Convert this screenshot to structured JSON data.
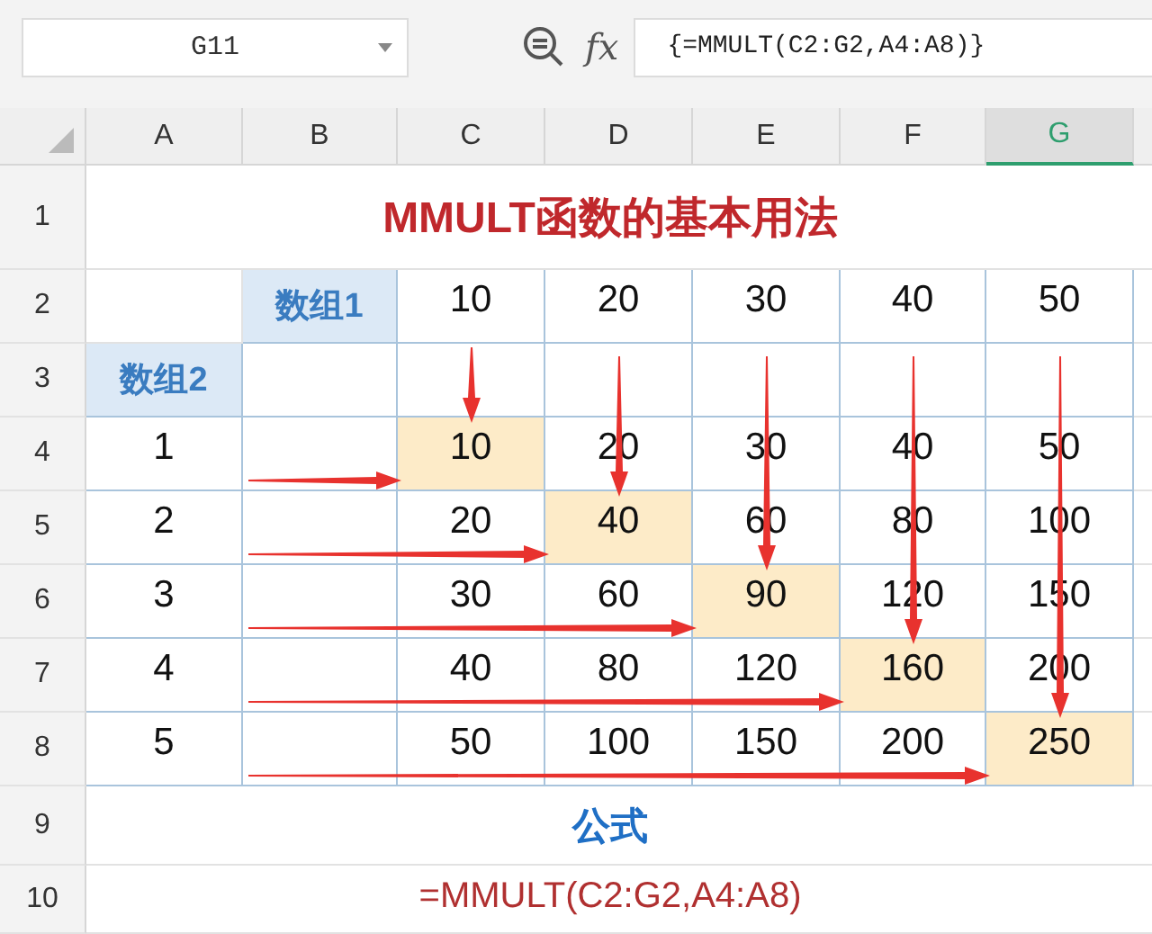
{
  "name_box": "G11",
  "fx_label": "fx",
  "formula_bar": "{=MMULT(C2:G2,A4:A8)}",
  "columns": [
    {
      "label": "A",
      "selected": false
    },
    {
      "label": "B",
      "selected": false
    },
    {
      "label": "C",
      "selected": false
    },
    {
      "label": "D",
      "selected": false
    },
    {
      "label": "E",
      "selected": false
    },
    {
      "label": "F",
      "selected": false
    },
    {
      "label": "G",
      "selected": true
    }
  ],
  "rows": [
    {
      "number": "1",
      "kind": "title",
      "text": "MMULT函数的基本用法"
    },
    {
      "number": "2",
      "kind": "data",
      "cells": [
        {
          "kind": "gap"
        },
        {
          "kind": "label",
          "text": "数组1"
        },
        {
          "kind": "value",
          "text": "10",
          "highlighted": false
        },
        {
          "kind": "value",
          "text": "20",
          "highlighted": false
        },
        {
          "kind": "value",
          "text": "30",
          "highlighted": false
        },
        {
          "kind": "value",
          "text": "40",
          "highlighted": false
        },
        {
          "kind": "value",
          "text": "50",
          "highlighted": false
        }
      ]
    },
    {
      "number": "3",
      "kind": "data",
      "cells": [
        {
          "kind": "label",
          "text": "数组2"
        },
        {
          "kind": "empty"
        },
        {
          "kind": "empty"
        },
        {
          "kind": "empty"
        },
        {
          "kind": "empty"
        },
        {
          "kind": "empty"
        },
        {
          "kind": "empty"
        }
      ]
    },
    {
      "number": "4",
      "kind": "data",
      "cells": [
        {
          "kind": "value",
          "text": "1",
          "highlighted": false
        },
        {
          "kind": "empty"
        },
        {
          "kind": "value",
          "text": "10",
          "highlighted": true
        },
        {
          "kind": "value",
          "text": "20",
          "highlighted": false
        },
        {
          "kind": "value",
          "text": "30",
          "highlighted": false
        },
        {
          "kind": "value",
          "text": "40",
          "highlighted": false
        },
        {
          "kind": "value",
          "text": "50",
          "highlighted": false
        }
      ]
    },
    {
      "number": "5",
      "kind": "data",
      "cells": [
        {
          "kind": "value",
          "text": "2",
          "highlighted": false
        },
        {
          "kind": "empty"
        },
        {
          "kind": "value",
          "text": "20",
          "highlighted": false
        },
        {
          "kind": "value",
          "text": "40",
          "highlighted": true
        },
        {
          "kind": "value",
          "text": "60",
          "highlighted": false
        },
        {
          "kind": "value",
          "text": "80",
          "highlighted": false
        },
        {
          "kind": "value",
          "text": "100",
          "highlighted": false
        }
      ]
    },
    {
      "number": "6",
      "kind": "data",
      "cells": [
        {
          "kind": "value",
          "text": "3",
          "highlighted": false
        },
        {
          "kind": "empty"
        },
        {
          "kind": "value",
          "text": "30",
          "highlighted": false
        },
        {
          "kind": "value",
          "text": "60",
          "highlighted": false
        },
        {
          "kind": "value",
          "text": "90",
          "highlighted": true
        },
        {
          "kind": "value",
          "text": "120",
          "highlighted": false
        },
        {
          "kind": "value",
          "text": "150",
          "highlighted": false
        }
      ]
    },
    {
      "number": "7",
      "kind": "data",
      "cells": [
        {
          "kind": "value",
          "text": "4",
          "highlighted": false
        },
        {
          "kind": "empty"
        },
        {
          "kind": "value",
          "text": "40",
          "highlighted": false
        },
        {
          "kind": "value",
          "text": "80",
          "highlighted": false
        },
        {
          "kind": "value",
          "text": "120",
          "highlighted": false
        },
        {
          "kind": "value",
          "text": "160",
          "highlighted": true
        },
        {
          "kind": "value",
          "text": "200",
          "highlighted": false
        }
      ]
    },
    {
      "number": "8",
      "kind": "data",
      "cells": [
        {
          "kind": "value",
          "text": "5",
          "highlighted": false
        },
        {
          "kind": "empty"
        },
        {
          "kind": "value",
          "text": "50",
          "highlighted": false
        },
        {
          "kind": "value",
          "text": "100",
          "highlighted": false
        },
        {
          "kind": "value",
          "text": "150",
          "highlighted": false
        },
        {
          "kind": "value",
          "text": "200",
          "highlighted": false
        },
        {
          "kind": "value",
          "text": "250",
          "highlighted": true
        }
      ]
    },
    {
      "number": "9",
      "kind": "caption",
      "text": "公式"
    },
    {
      "number": "10",
      "kind": "formula",
      "text": "=MMULT(C2:G2,A4:A8)"
    }
  ]
}
